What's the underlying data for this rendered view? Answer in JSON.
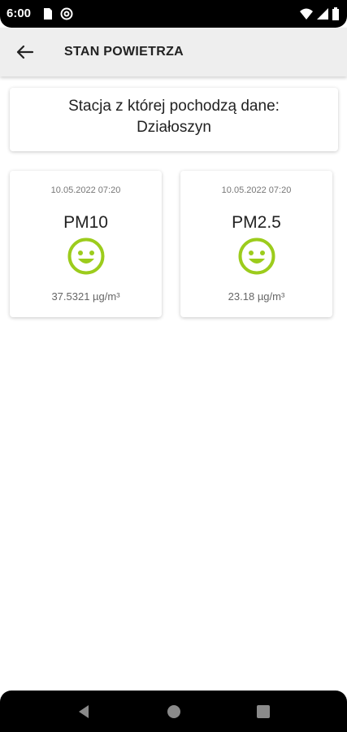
{
  "status_bar": {
    "time": "6:00",
    "icons": [
      "sd-card-icon",
      "at-sign-icon",
      "wifi-icon",
      "signal-icon",
      "battery-icon"
    ]
  },
  "app_bar": {
    "title": "STAN POWIETRZA",
    "back_icon": "arrow-left-icon"
  },
  "station": {
    "label": "Stacja z której pochodzą dane:",
    "name": "Działoszyn"
  },
  "measurements": [
    {
      "date": "10.05.2022 07:20",
      "name": "PM10",
      "value": "37.5321 µg/m³",
      "status_icon": "smiley-icon",
      "status_color": "#9ccc1c"
    },
    {
      "date": "10.05.2022 07:20",
      "name": "PM2.5",
      "value": "23.18 µg/m³",
      "status_icon": "smiley-icon",
      "status_color": "#9ccc1c"
    }
  ],
  "nav_bar": {
    "icons": [
      "back-triangle-icon",
      "home-circle-icon",
      "recents-square-icon"
    ]
  },
  "colors": {
    "app_bar_bg": "#eeeeee",
    "good_air": "#9ccc1c"
  }
}
